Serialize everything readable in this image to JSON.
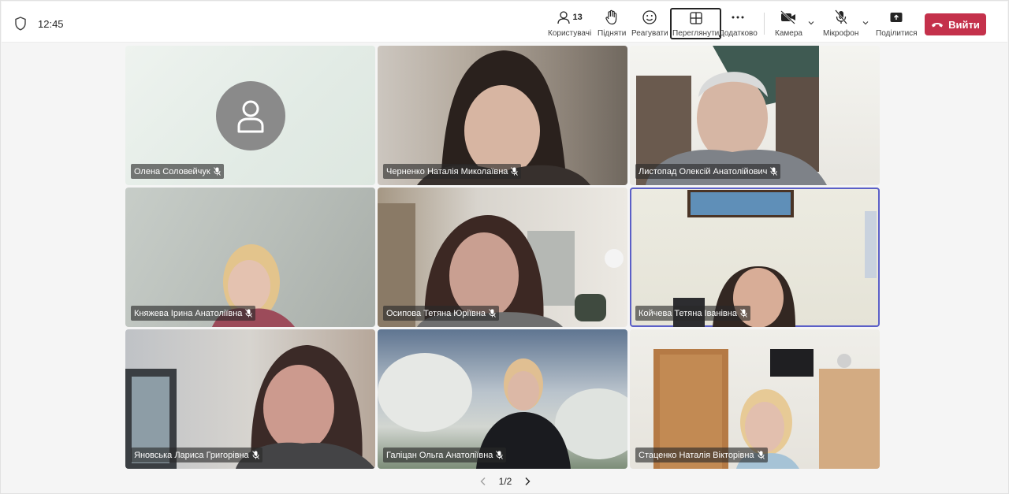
{
  "header": {
    "time": "12:45",
    "participants_count": "13",
    "buttons": {
      "people": "Користувачі",
      "raise": "Підняти",
      "react": "Реагувати",
      "view": "Переглянути",
      "more": "Додатково",
      "camera": "Камера",
      "mic": "Мікрофон",
      "share": "Поділитися",
      "leave": "Вийти"
    },
    "colors": {
      "leave_bg": "#c4314b",
      "active_speaker_border": "#5b5fc7"
    }
  },
  "participants": [
    {
      "name": "Олена Соловейчук",
      "has_video": false
    },
    {
      "name": "Черненко Наталія Миколаївна",
      "has_video": true
    },
    {
      "name": "Листопад Олексій Анатолійович",
      "has_video": true
    },
    {
      "name": "Княжева Ірина Анатоліївна",
      "has_video": true
    },
    {
      "name": "Осипова Тетяна Юріївна",
      "has_video": true
    },
    {
      "name": "Койчева Тетяна Іванівна",
      "has_video": true,
      "speaking": true
    },
    {
      "name": "Яновська Лариса Григорівна",
      "has_video": true
    },
    {
      "name": "Галіцан Ольга Анатоліївна",
      "has_video": true
    },
    {
      "name": "Стаценко Наталія Вікторівна",
      "has_video": true
    }
  ],
  "pagination": {
    "label": "1/2"
  }
}
